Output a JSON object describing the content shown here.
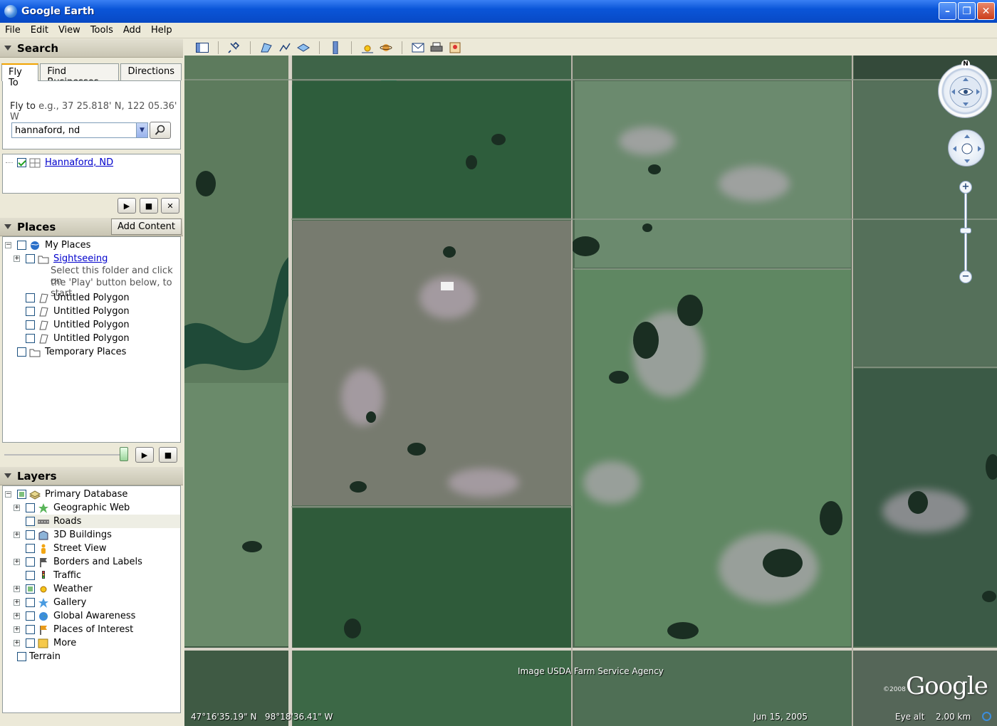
{
  "window": {
    "title": "Google Earth",
    "minimize": "–",
    "maximize": "❐",
    "close": "✕"
  },
  "menu": [
    "File",
    "Edit",
    "View",
    "Tools",
    "Add",
    "Help"
  ],
  "search": {
    "header": "Search",
    "tabs": [
      "Fly To",
      "Find Businesses",
      "Directions"
    ],
    "flyto_label": "Fly to",
    "flyto_hint": "e.g., 37 25.818' N, 122 05.36' W",
    "query": "hannaford, nd",
    "result": "Hannaford, ND"
  },
  "places": {
    "header": "Places",
    "add_content": "Add Content",
    "items": [
      {
        "label": "My Places"
      },
      {
        "label": "Sightseeing"
      },
      {
        "label": "Untitled Polygon"
      },
      {
        "label": "Untitled Polygon"
      },
      {
        "label": "Untitled Polygon"
      },
      {
        "label": "Untitled Polygon"
      },
      {
        "label": "Temporary Places"
      }
    ],
    "sightseeing_help_1": "Select this folder and click on",
    "sightseeing_help_2": "the 'Play' button below, to start"
  },
  "layers": {
    "header": "Layers",
    "items": [
      {
        "label": "Primary Database"
      },
      {
        "label": "Geographic Web"
      },
      {
        "label": "Roads"
      },
      {
        "label": "3D Buildings"
      },
      {
        "label": "Street View"
      },
      {
        "label": "Borders and Labels"
      },
      {
        "label": "Traffic"
      },
      {
        "label": "Weather"
      },
      {
        "label": "Gallery"
      },
      {
        "label": "Global Awareness"
      },
      {
        "label": "Places of Interest"
      },
      {
        "label": "More"
      },
      {
        "label": "Terrain"
      }
    ]
  },
  "map": {
    "attribution": "Image USDA Farm Service Agency",
    "copyright": "©2008",
    "logo": "Google",
    "compass_n": "N",
    "lat": "47°16'35.19\" N",
    "lon": "98°18'36.41\" W",
    "date": "Jun 15, 2005",
    "eye_alt_label": "Eye alt",
    "eye_alt": "2.00 km"
  }
}
